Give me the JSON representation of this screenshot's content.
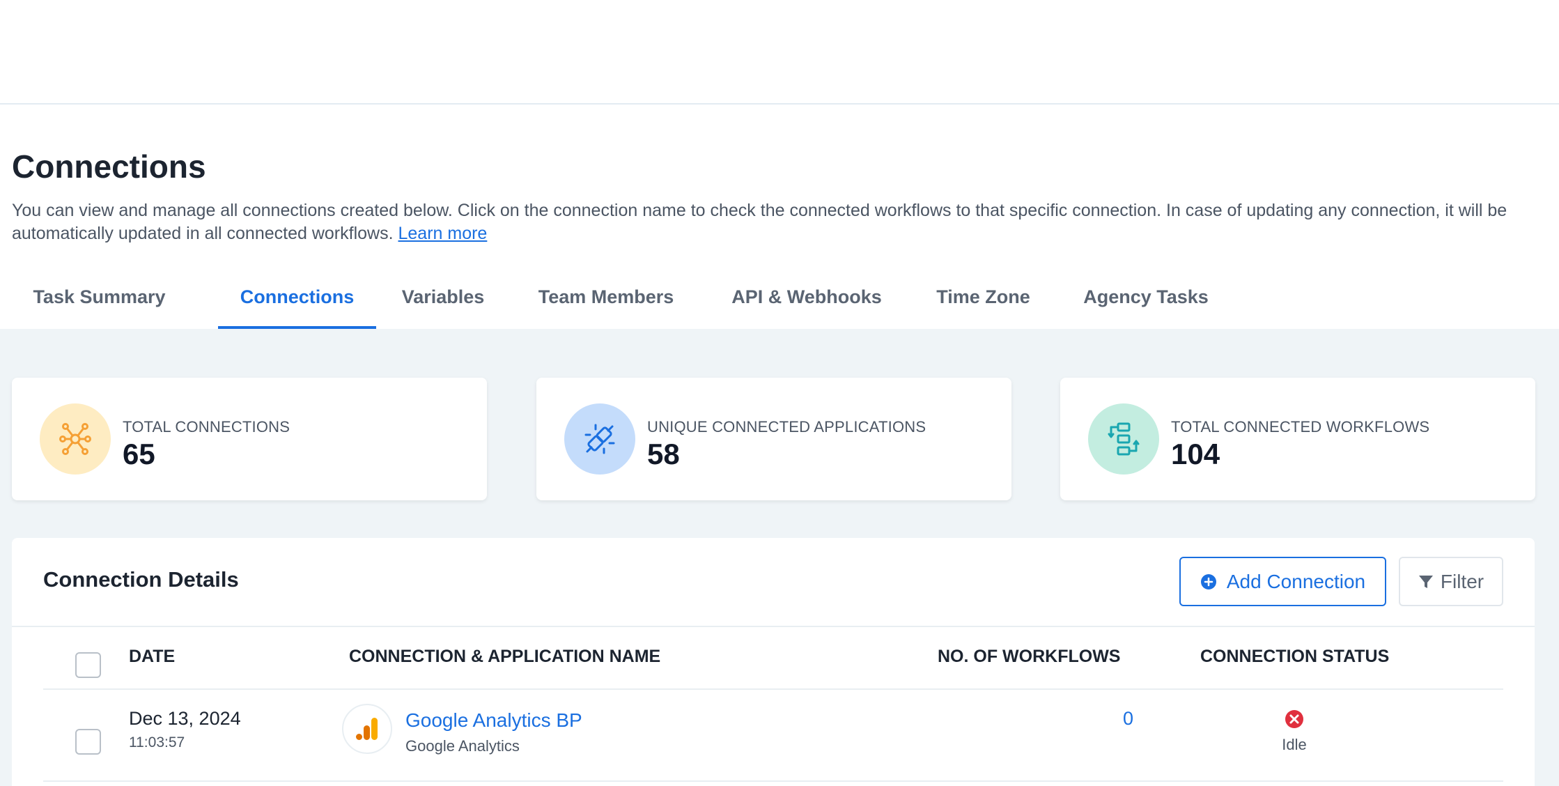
{
  "page": {
    "title": "Connections",
    "description": "You can view and manage all connections created below. Click on the connection name to check the connected workflows to that specific connection. In case of updating any connection, it will be automatically updated in all connected workflows.",
    "learn_more": "Learn more"
  },
  "tabs": [
    {
      "label": "Task Summary"
    },
    {
      "label": "Connections",
      "active": true
    },
    {
      "label": "Variables"
    },
    {
      "label": "Team Members"
    },
    {
      "label": "API & Webhooks"
    },
    {
      "label": "Time Zone"
    },
    {
      "label": "Agency Tasks"
    }
  ],
  "stats": [
    {
      "label": "TOTAL CONNECTIONS",
      "value": "65",
      "icon": "network-icon",
      "color": "#f5a035"
    },
    {
      "label": "UNIQUE CONNECTED APPLICATIONS",
      "value": "58",
      "icon": "plug-icon",
      "color": "#1a6fe0"
    },
    {
      "label": "TOTAL CONNECTED WORKFLOWS",
      "value": "104",
      "icon": "workflow-icon",
      "color": "#19a6b0"
    }
  ],
  "details": {
    "title": "Connection Details",
    "add_label": "Add Connection",
    "filter_label": "Filter",
    "columns": [
      "DATE",
      "CONNECTION & APPLICATION NAME",
      "NO. OF WORKFLOWS",
      "CONNECTION STATUS"
    ],
    "rows": [
      {
        "date": "Dec 13, 2024",
        "time": "11:03:57",
        "connection_name": "Google Analytics BP",
        "app_name": "Google Analytics",
        "workflows": "0",
        "status": "Idle"
      }
    ]
  },
  "colors": {
    "accent": "#1a6fe0",
    "status_idle": "#e0303e"
  }
}
